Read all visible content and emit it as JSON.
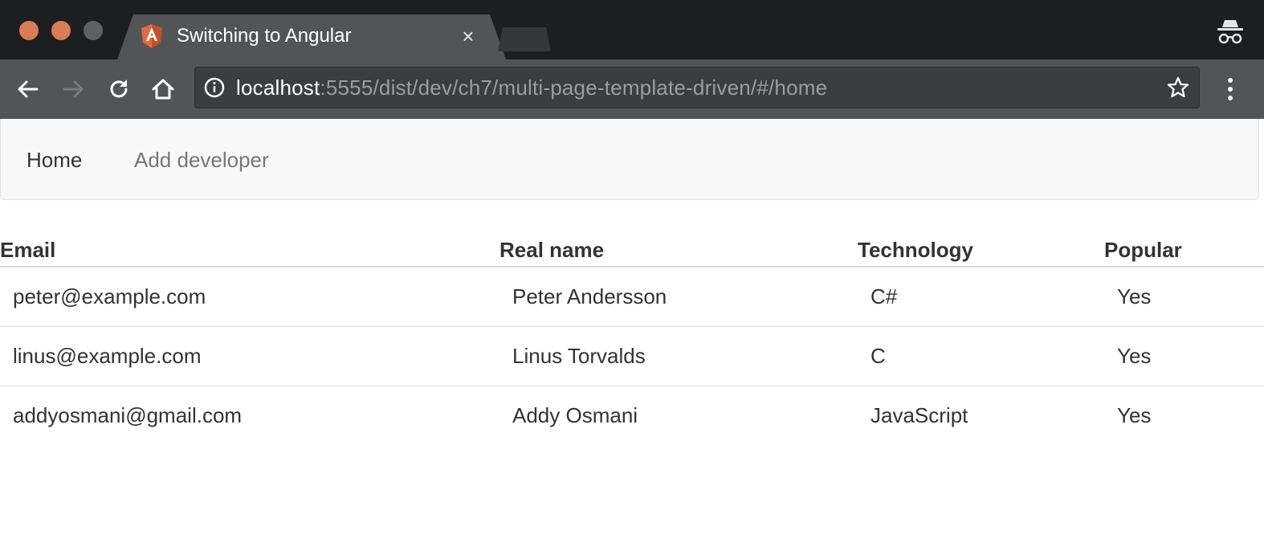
{
  "browser": {
    "tab_title": "Switching to Angular",
    "tab_close": "×",
    "url_host": "localhost",
    "url_rest": ":5555/dist/dev/ch7/multi-page-template-driven/#/home",
    "icons": {
      "back": "back-arrow-icon",
      "forward": "forward-arrow-icon",
      "reload": "reload-icon",
      "home": "home-icon",
      "info": "info-icon",
      "bookmark": "star-icon",
      "menu": "kebab-menu-icon",
      "incognito": "incognito-icon",
      "favicon": "angular-logo-icon"
    },
    "colors": {
      "titlebar": "#1d1e20",
      "toolbar": "#535456",
      "traffic_close": "#d97d57",
      "traffic_min": "#d97d57",
      "traffic_max": "#5f6063",
      "angular": "#dd6b45"
    }
  },
  "navbar": {
    "home_label": "Home",
    "add_label": "Add developer"
  },
  "table": {
    "headers": {
      "email": "Email",
      "real_name": "Real name",
      "technology": "Technology",
      "popular": "Popular"
    },
    "rows": [
      {
        "email": "peter@example.com",
        "real_name": "Peter Andersson",
        "technology": "C#",
        "popular": "Yes"
      },
      {
        "email": "linus@example.com",
        "real_name": "Linus Torvalds",
        "technology": "C",
        "popular": "Yes"
      },
      {
        "email": "addyosmani@gmail.com",
        "real_name": "Addy Osmani",
        "technology": "JavaScript",
        "popular": "Yes"
      }
    ]
  }
}
